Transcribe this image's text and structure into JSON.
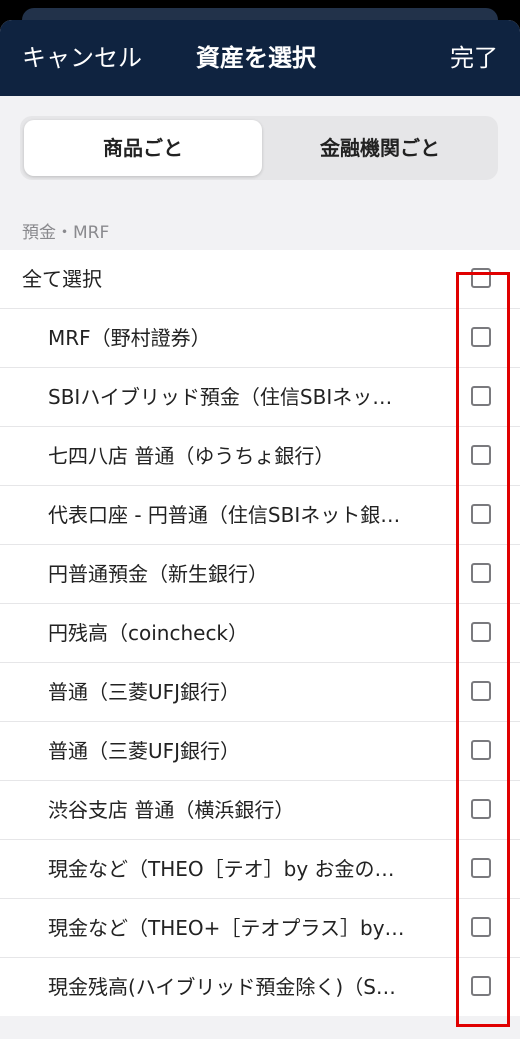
{
  "nav": {
    "cancel_label": "キャンセル",
    "title": "資産を選択",
    "done_label": "完了"
  },
  "segment": {
    "by_product": "商品ごと",
    "by_institution": "金融機関ごと",
    "selected": "by_product"
  },
  "section": {
    "header": "預金・MRF",
    "select_all_label": "全て選択",
    "items": [
      {
        "label": "MRF（野村證券）",
        "checked": false
      },
      {
        "label": "SBIハイブリッド預金（住信SBIネッ…",
        "checked": false
      },
      {
        "label": "七四八店 普通（ゆうちょ銀行）",
        "checked": false
      },
      {
        "label": "代表口座 - 円普通（住信SBIネット銀…",
        "checked": false
      },
      {
        "label": "円普通預金（新生銀行）",
        "checked": false
      },
      {
        "label": "円残高（coincheck）",
        "checked": false
      },
      {
        "label": "普通（三菱UFJ銀行）",
        "checked": false
      },
      {
        "label": "普通（三菱UFJ銀行）",
        "checked": false
      },
      {
        "label": "渋谷支店 普通（横浜銀行）",
        "checked": false
      },
      {
        "label": "現金など（THEO［テオ］by お金の…",
        "checked": false
      },
      {
        "label": "現金など（THEO+［テオプラス］by…",
        "checked": false
      },
      {
        "label": "現金残高(ハイブリッド預金除く)（S…",
        "checked": false
      }
    ]
  },
  "colors": {
    "nav_background": "#0f2340",
    "highlight_border": "#e00000",
    "checkbox_border": "#7a7a7e"
  }
}
